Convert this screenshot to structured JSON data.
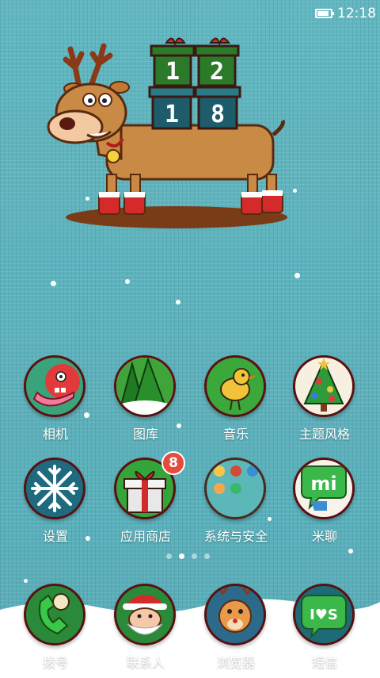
{
  "status_bar": {
    "time": "12:18",
    "battery_level": 0.85
  },
  "wallpaper": {
    "calendar_digits": [
      "1",
      "2",
      "1",
      "8"
    ]
  },
  "apps": [
    {
      "label": "相机",
      "icon": "camera-icon"
    },
    {
      "label": "图库",
      "icon": "gallery-icon"
    },
    {
      "label": "音乐",
      "icon": "music-icon"
    },
    {
      "label": "主题风格",
      "icon": "themes-icon"
    },
    {
      "label": "设置",
      "icon": "settings-icon"
    },
    {
      "label": "应用商店",
      "icon": "app-store-icon",
      "badge": "8"
    },
    {
      "label": "系统与安全",
      "icon": "system-security-folder-icon"
    },
    {
      "label": "米聊",
      "icon": "miliao-icon"
    }
  ],
  "page_indicator": {
    "count": 4,
    "current": 1
  },
  "dock": [
    {
      "label": "拨号",
      "icon": "phone-icon"
    },
    {
      "label": "联系人",
      "icon": "contacts-icon"
    },
    {
      "label": "浏览器",
      "icon": "browser-icon"
    },
    {
      "label": "短信",
      "icon": "messages-icon",
      "logo_text": "I♥S"
    }
  ],
  "miliao_logo_text": "mi"
}
